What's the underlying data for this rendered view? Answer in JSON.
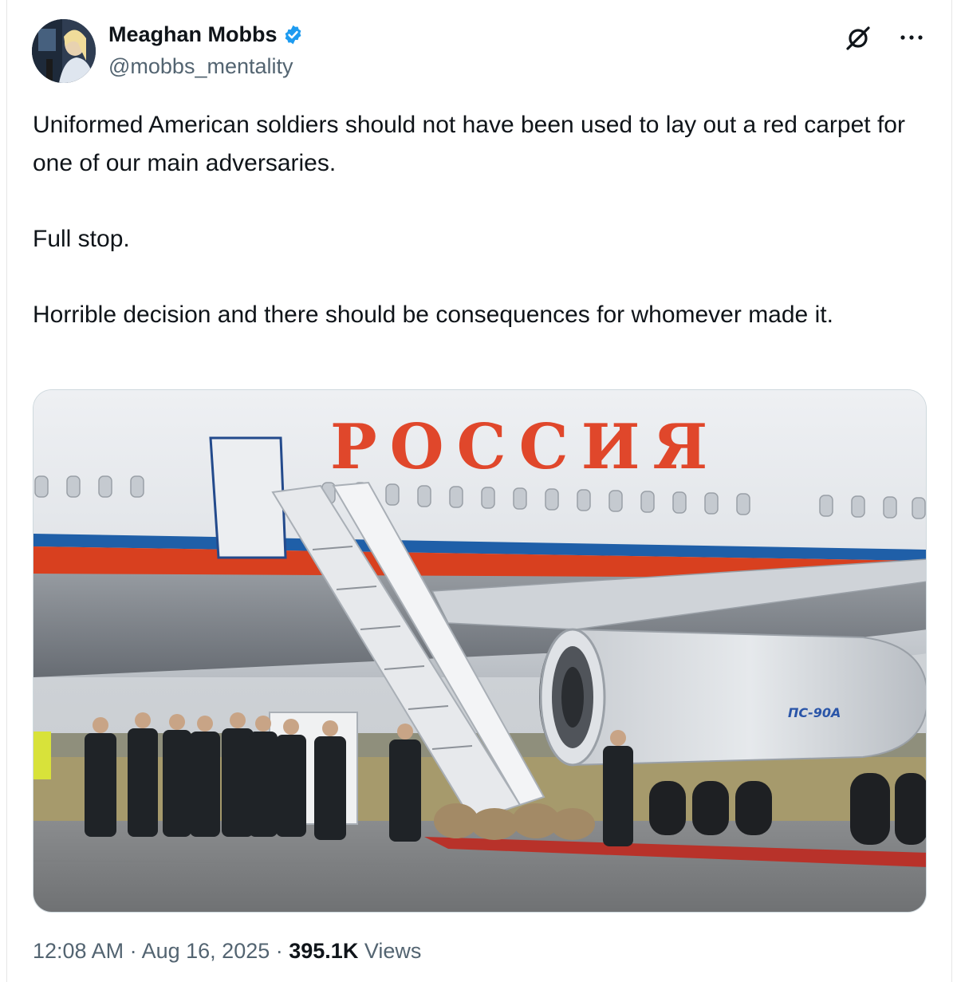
{
  "author": {
    "display_name": "Meaghan Mobbs",
    "handle": "@mobbs_mentality",
    "verified_icon": "verified-badge-icon",
    "verified_color": "#1d9bf0"
  },
  "actions": {
    "grok_icon": "grok-icon",
    "more_icon": "more-options-icon"
  },
  "tweet": {
    "paragraphs": [
      "Uniformed American soldiers should not have been used to lay out a red carpet for one of our main adversaries.",
      "Full stop.",
      "Horrible decision and there should be consequences for whomever made it."
    ]
  },
  "media": {
    "fuselage_text": "РОССИЯ",
    "engine_text": "ПС-90А"
  },
  "meta": {
    "time": "12:08 AM",
    "separator": " · ",
    "date": "Aug 16, 2025",
    "views_count": "395.1K",
    "views_label": " Views"
  },
  "colors": {
    "text_primary": "#0f1419",
    "text_secondary": "#536471",
    "stripe_blue": "#1f5fa8",
    "stripe_red": "#d8401f",
    "fuselage_text_red": "#e0472b"
  }
}
